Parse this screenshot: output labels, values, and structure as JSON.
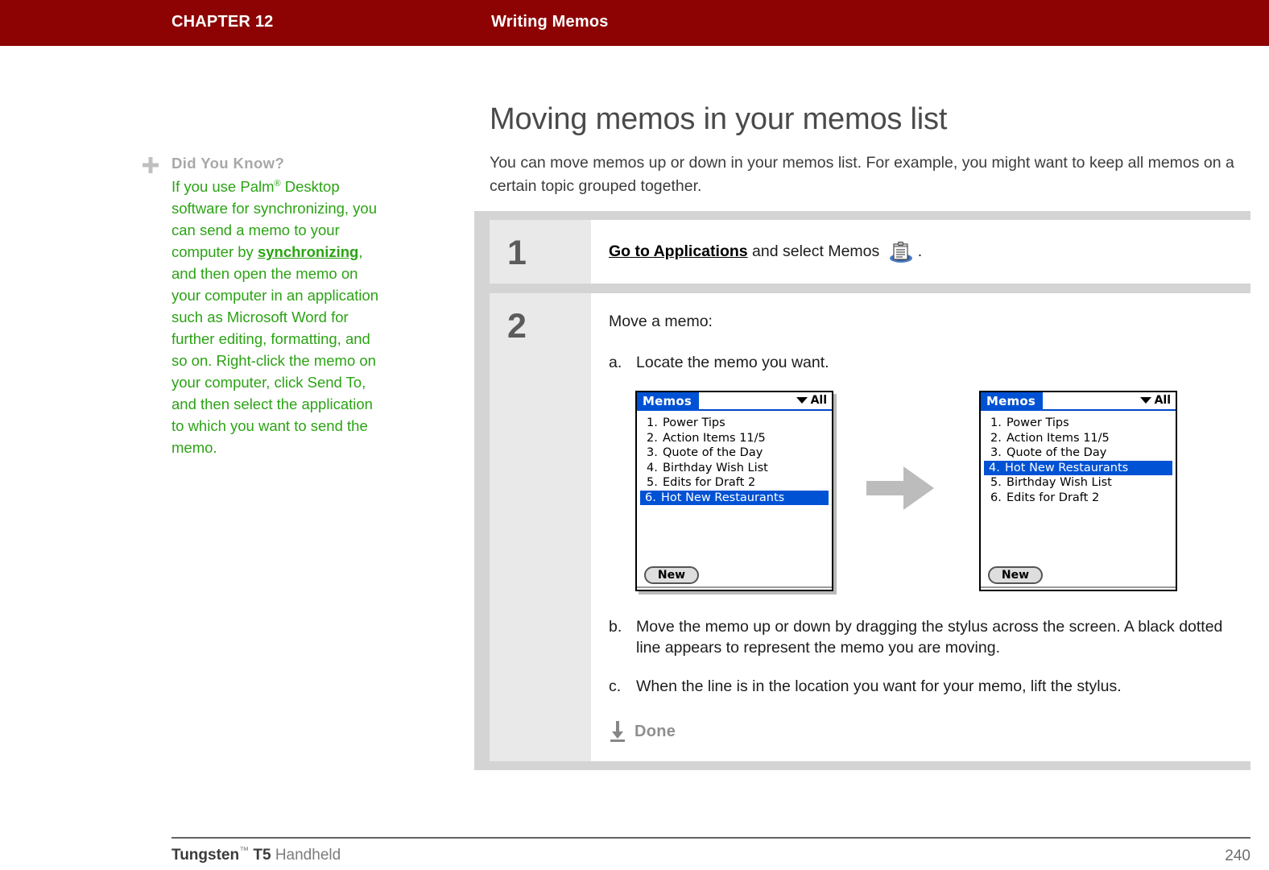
{
  "header": {
    "chapter": "CHAPTER 12",
    "title": "Writing Memos"
  },
  "sidebar": {
    "icon": "plus-icon",
    "heading": "Did You Know?",
    "body_part1": "If you use Palm",
    "body_reg": "®",
    "body_part2": " Desktop software for synchronizing, you can send a memo to your computer by ",
    "link": "synchronizing",
    "body_part3": ", and then open the memo on your computer in an application such as Microsoft Word for further editing, formatting, and so on. Right-click the memo on your computer, click Send To, and then select the application to which you want to send the memo."
  },
  "main": {
    "title": "Moving memos in your memos list",
    "intro": "You can move memos up or down in your memos list. For example, you might want to keep all memos on a certain topic grouped together."
  },
  "steps": [
    {
      "number": "1",
      "link_text": "Go to Applications",
      "rest_text": " and select Memos ",
      "icon": "memos-app-icon",
      "period": "."
    },
    {
      "number": "2",
      "intro": "Move a memo:",
      "sub_a_label": "a.",
      "sub_a_text": "Locate the memo you want.",
      "sub_b_label": "b.",
      "sub_b_text": "Move the memo up or down by dragging the stylus across the screen. A black dotted line appears to represent the memo you are moving.",
      "sub_c_label": "c.",
      "sub_c_text": "When the line is in the location you want for your memo, lift the stylus.",
      "done_label": "Done",
      "done_icon": "down-arrow-icon"
    }
  ],
  "pda_before": {
    "app_title": "Memos",
    "category": "All",
    "category_icon": "chevron-down-icon",
    "items": [
      {
        "index": "1.",
        "label": "Power Tips",
        "selected": false
      },
      {
        "index": "2.",
        "label": "Action Items 11/5",
        "selected": false
      },
      {
        "index": "3.",
        "label": "Quote of the Day",
        "selected": false
      },
      {
        "index": "4.",
        "label": "Birthday Wish List",
        "selected": false
      },
      {
        "index": "5.",
        "label": "Edits for Draft 2",
        "selected": false
      },
      {
        "index": "6.",
        "label": "Hot New Restaurants",
        "selected": true
      }
    ],
    "new_button": "New"
  },
  "pda_after": {
    "app_title": "Memos",
    "category": "All",
    "category_icon": "chevron-down-icon",
    "items": [
      {
        "index": "1.",
        "label": "Power Tips",
        "selected": false
      },
      {
        "index": "2.",
        "label": "Action Items 11/5",
        "selected": false
      },
      {
        "index": "3.",
        "label": "Quote of the Day",
        "selected": false
      },
      {
        "index": "4.",
        "label": "Hot New Restaurants",
        "selected": true
      },
      {
        "index": "5.",
        "label": "Birthday Wish List",
        "selected": false
      },
      {
        "index": "6.",
        "label": "Edits for Draft 2",
        "selected": false
      }
    ],
    "new_button": "New"
  },
  "transition": {
    "icon": "right-arrow-icon"
  },
  "footer": {
    "product": "Tungsten",
    "tm": "™",
    "model": " T5",
    "suffix": " Handheld",
    "page_number": "240"
  },
  "colors": {
    "header_red": "#8d0303",
    "tip_green": "#2ba314",
    "panel_gray": "#d4d4d4",
    "step_cell_gray": "#e9e9e9",
    "pda_blue": "#0052d4"
  }
}
